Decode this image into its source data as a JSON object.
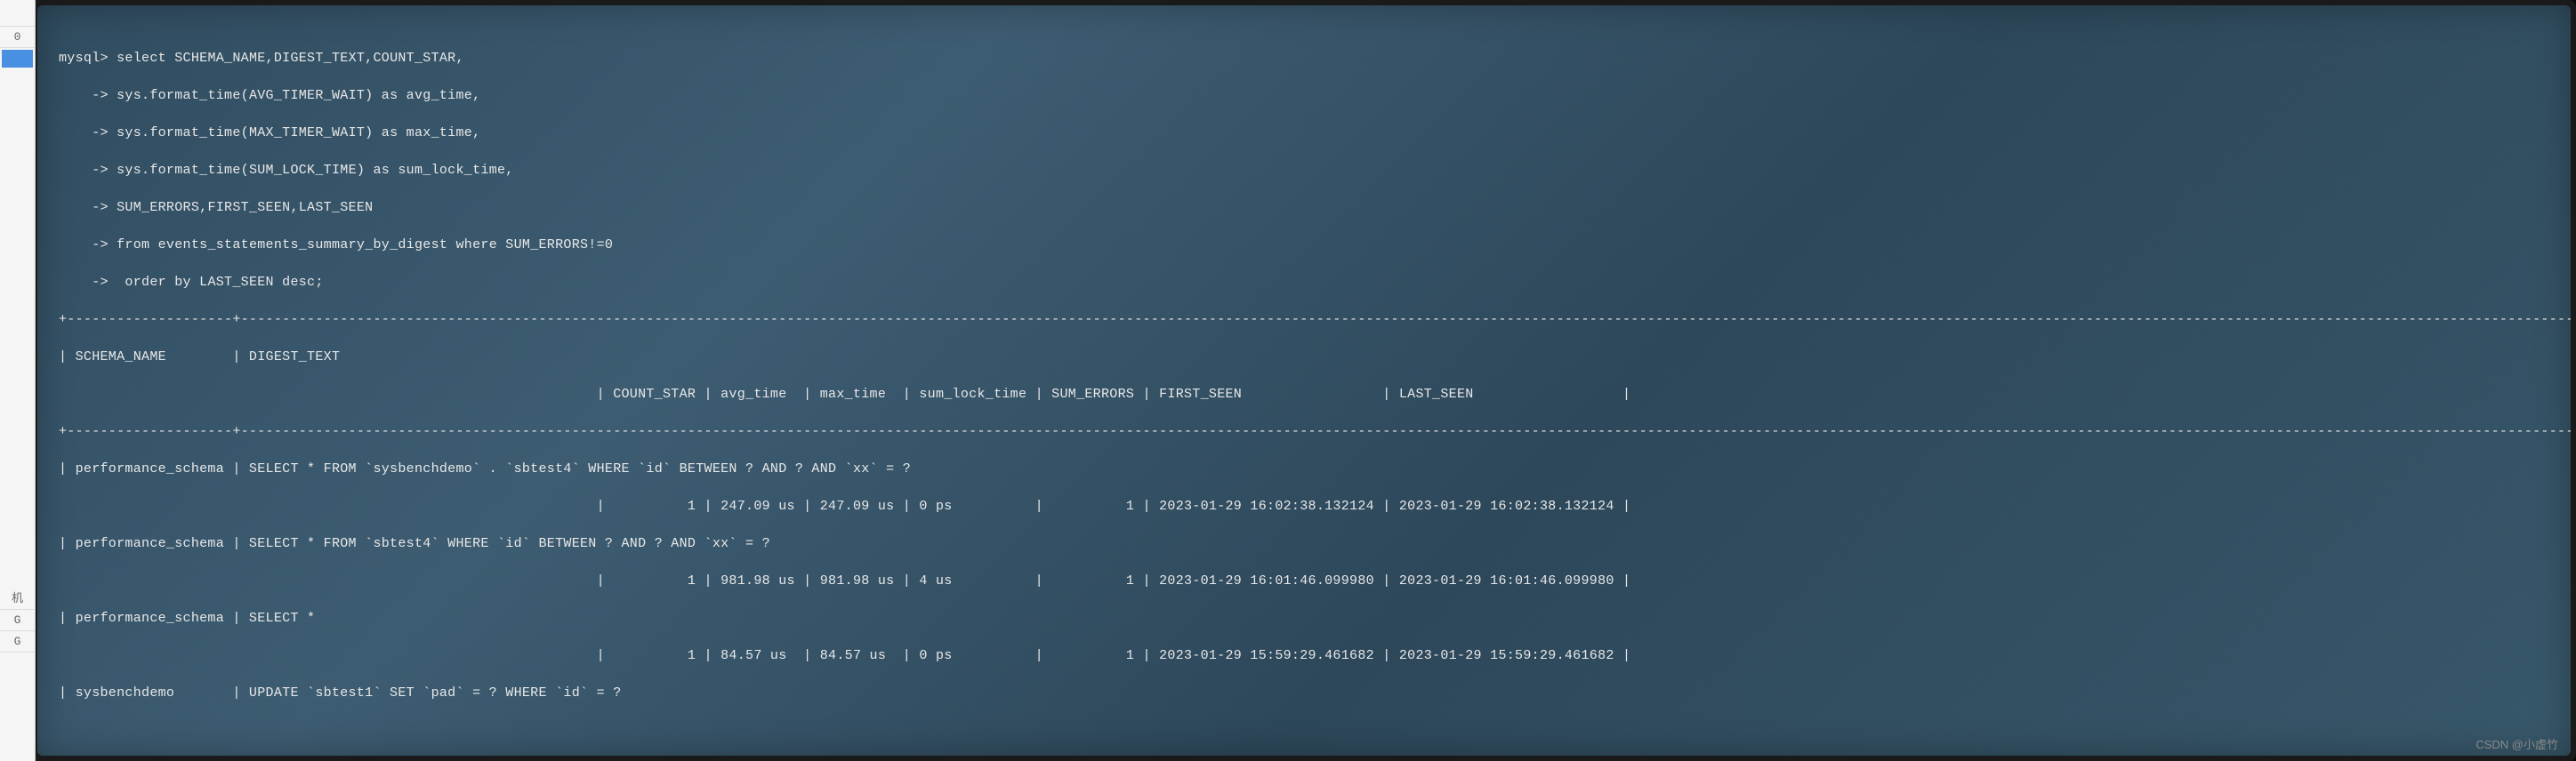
{
  "sidebar": {
    "items": [
      "机",
      "G",
      "G"
    ],
    "num": "0"
  },
  "terminal": {
    "prompt": "mysql>",
    "continuation": "    ->",
    "query_lines": [
      "select SCHEMA_NAME,DIGEST_TEXT,COUNT_STAR,",
      "sys.format_time(AVG_TIMER_WAIT) as avg_time,",
      "sys.format_time(MAX_TIMER_WAIT) as max_time,",
      "sys.format_time(SUM_LOCK_TIME) as sum_lock_time,",
      "SUM_ERRORS,FIRST_SEEN,LAST_SEEN",
      "from events_statements_summary_by_digest where SUM_ERRORS!=0",
      " order by LAST_SEEN desc;"
    ],
    "separator": "+--------------------+------------------------------------------------------------------------------------------------------------------------------------------------------------------------------------------------------------------------------------------------------------------------------------------------------------------------------------+------------+-----------+-----------+---------------+------------+----------------------------+----------------------------+",
    "headers": {
      "line1": "| SCHEMA_NAME        | DIGEST_TEXT",
      "line2": "                                                                 | COUNT_STAR | avg_time  | max_time  | sum_lock_time | SUM_ERRORS | FIRST_SEEN                 | LAST_SEEN                  |"
    },
    "rows": [
      {
        "line1": "| performance_schema | SELECT * FROM `sysbenchdemo` . `sbtest4` WHERE `id` BETWEEN ? AND ? AND `xx` = ?",
        "line2": "                                                                 |          1 | 247.09 us | 247.09 us | 0 ps          |          1 | 2023-01-29 16:02:38.132124 | 2023-01-29 16:02:38.132124 |"
      },
      {
        "line1": "| performance_schema | SELECT * FROM `sbtest4` WHERE `id` BETWEEN ? AND ? AND `xx` = ?",
        "line2": "                                                                 |          1 | 981.98 us | 981.98 us | 4 us          |          1 | 2023-01-29 16:01:46.099980 | 2023-01-29 16:01:46.099980 |"
      },
      {
        "line1": "| performance_schema | SELECT *",
        "line2": "                                                                 |          1 | 84.57 us  | 84.57 us  | 0 ps          |          1 | 2023-01-29 15:59:29.461682 | 2023-01-29 15:59:29.461682 |"
      },
      {
        "line1": "| sysbenchdemo       | UPDATE `sbtest1` SET `pad` = ? WHERE `id` = ?",
        "line2": ""
      }
    ]
  },
  "watermark": "CSDN @小虚竹",
  "chart_data": {
    "type": "table",
    "title": "MySQL events_statements_summary_by_digest query output",
    "columns": [
      "SCHEMA_NAME",
      "DIGEST_TEXT",
      "COUNT_STAR",
      "avg_time",
      "max_time",
      "sum_lock_time",
      "SUM_ERRORS",
      "FIRST_SEEN",
      "LAST_SEEN"
    ],
    "rows": [
      [
        "performance_schema",
        "SELECT * FROM `sysbenchdemo` . `sbtest4` WHERE `id` BETWEEN ? AND ? AND `xx` = ?",
        1,
        "247.09 us",
        "247.09 us",
        "0 ps",
        1,
        "2023-01-29 16:02:38.132124",
        "2023-01-29 16:02:38.132124"
      ],
      [
        "performance_schema",
        "SELECT * FROM `sbtest4` WHERE `id` BETWEEN ? AND ? AND `xx` = ?",
        1,
        "981.98 us",
        "981.98 us",
        "4 us",
        1,
        "2023-01-29 16:01:46.099980",
        "2023-01-29 16:01:46.099980"
      ],
      [
        "performance_schema",
        "SELECT *",
        1,
        "84.57 us",
        "84.57 us",
        "0 ps",
        1,
        "2023-01-29 15:59:29.461682",
        "2023-01-29 15:59:29.461682"
      ],
      [
        "sysbenchdemo",
        "UPDATE `sbtest1` SET `pad` = ? WHERE `id` = ?",
        null,
        null,
        null,
        null,
        null,
        null,
        null
      ]
    ]
  }
}
